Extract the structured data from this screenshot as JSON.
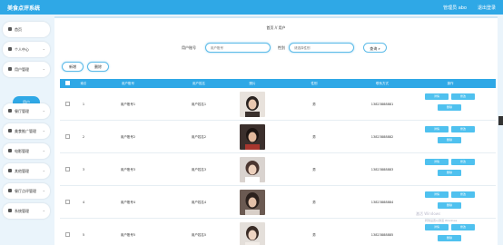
{
  "app": {
    "title": "美食点评系统",
    "user_info": "管理员 abo",
    "logout": "退出登录"
  },
  "sidebar": {
    "items": [
      {
        "label": "首页",
        "chevron": ""
      },
      {
        "label": "个人中心",
        "chevron": "⌄"
      },
      {
        "label": "用户管理",
        "chevron": "⌄"
      },
      {
        "label": "餐厅管理",
        "chevron": "⌄"
      },
      {
        "label": "美食推广管理",
        "chevron": "⌄"
      },
      {
        "label": "电影管理",
        "chevron": "⌄"
      },
      {
        "label": "其他管理",
        "chevron": "⌄"
      },
      {
        "label": "餐厅点评管理",
        "chevron": "⌄"
      },
      {
        "label": "系统管理",
        "chevron": "⌄"
      }
    ],
    "active_sub": "用户"
  },
  "breadcrumb": {
    "home": "首页",
    "sep": "//",
    "current": "用户"
  },
  "search": {
    "account_label": "用户账号",
    "account_placeholder": "用户账号",
    "gender_label": "性别",
    "gender_placeholder": "请选择性别",
    "button": "查询 ⌕"
  },
  "actions": {
    "add": "新增",
    "delete": "删除"
  },
  "table": {
    "headers": [
      "索引",
      "用户账号",
      "用户姓名",
      "照片",
      "性别",
      "联系方式",
      "操作"
    ],
    "rows": [
      {
        "index": "1",
        "account": "用户账号1",
        "name": "用户姓名1",
        "gender": "男",
        "phone": "13823888881"
      },
      {
        "index": "2",
        "account": "用户账号2",
        "name": "用户姓名2",
        "gender": "男",
        "phone": "13823888882"
      },
      {
        "index": "3",
        "account": "用户账号3",
        "name": "用户姓名3",
        "gender": "男",
        "phone": "13823888883"
      },
      {
        "index": "4",
        "account": "用户账号4",
        "name": "用户姓名4",
        "gender": "男",
        "phone": "13823888884"
      },
      {
        "index": "5",
        "account": "用户账号5",
        "name": "用户姓名5",
        "gender": "男",
        "phone": "13823888885"
      }
    ],
    "ops": {
      "detail": "详情",
      "edit": "修改",
      "delete": "删除"
    }
  },
  "watermark": {
    "line1": "激活 Windows",
    "line2": "转到设置以激活 Windows"
  },
  "colors": {
    "accent": "#2fa8e6",
    "op_button": "#4fc1ef"
  }
}
